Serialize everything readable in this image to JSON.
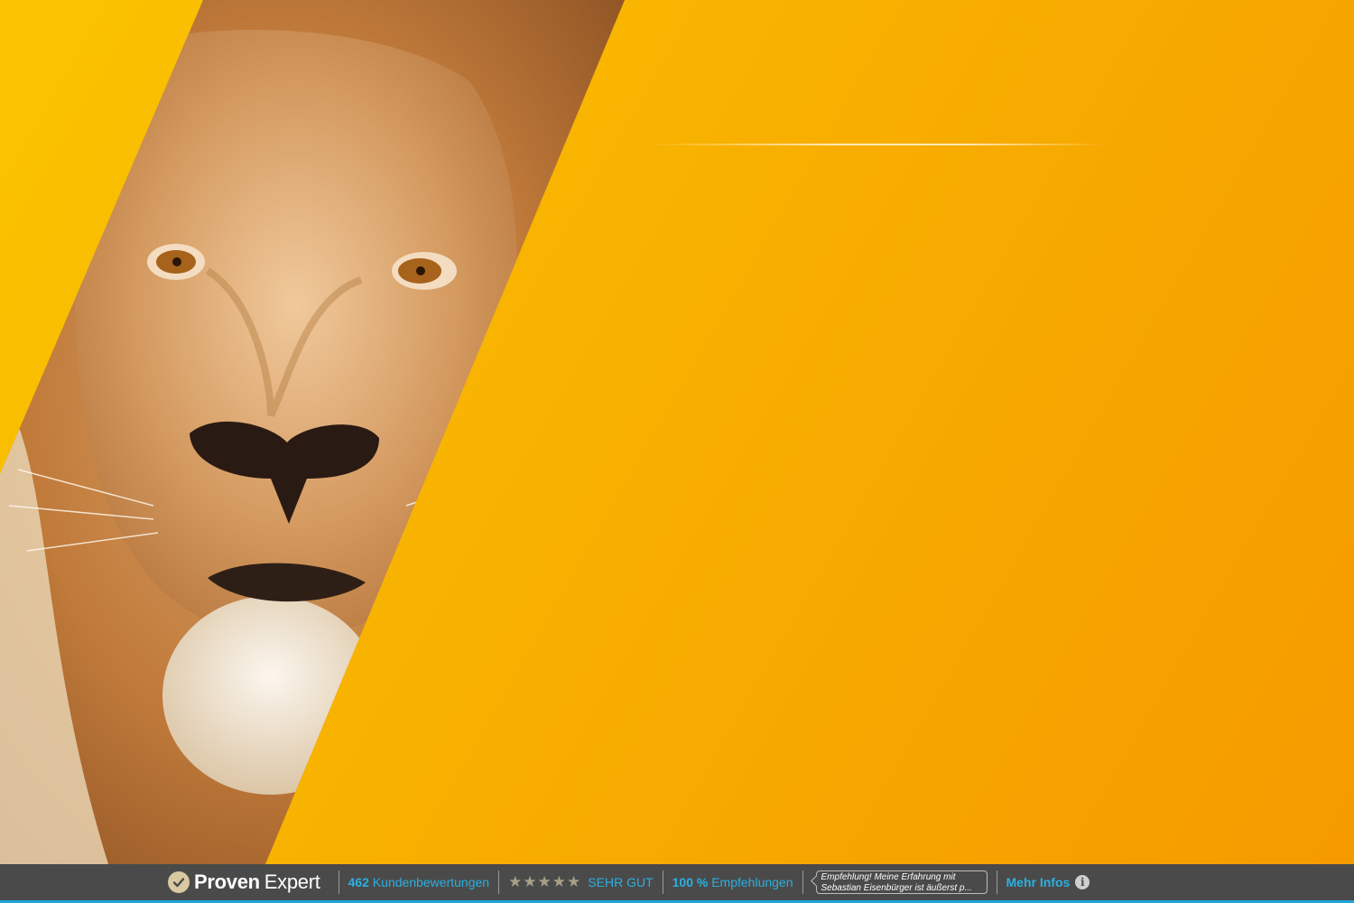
{
  "proven_expert": {
    "brand_bold": "Proven",
    "brand_light": "Expert",
    "review_count": "462",
    "review_label": "Kundenbewertungen",
    "stars": "★★★★★",
    "rating_text": "SEHR GUT",
    "recommend_percent": "100 %",
    "recommend_label": "Empfehlungen",
    "recommendation_line1": "Empfehlung! Meine Erfahrung mit",
    "recommendation_line2": "Sebastian Eisenbürger ist äußerst p...",
    "more_info": "Mehr Infos",
    "info_icon_glyph": "i",
    "check_icon": "check-circle-icon",
    "colors": {
      "bar": "#4a4a4a",
      "accent": "#1ea8d8",
      "stars": "#a89f88"
    }
  },
  "hero": {
    "background_colors": [
      "#fbc400",
      "#f59a00"
    ],
    "image": "lion-face-photo"
  }
}
